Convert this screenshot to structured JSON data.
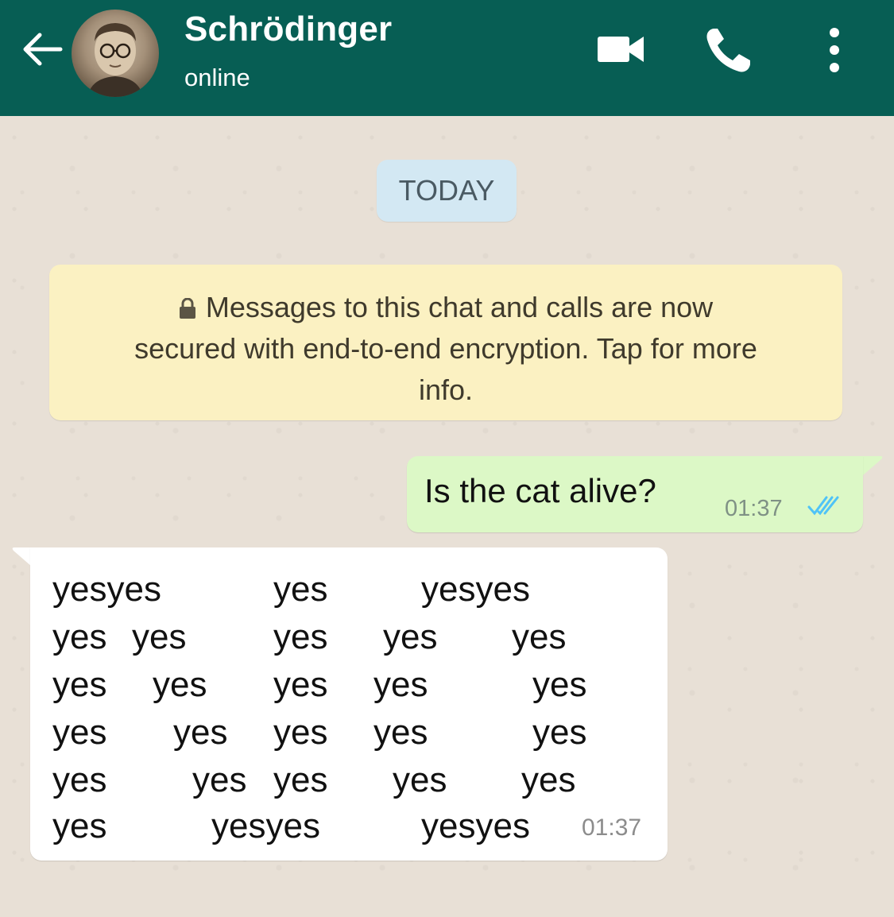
{
  "header": {
    "contact_name": "Schrödinger",
    "status": "online",
    "icons": [
      "back-arrow-icon",
      "avatar",
      "video-call-icon",
      "phone-icon",
      "more-options-icon"
    ],
    "background_color": "#075e54"
  },
  "chat": {
    "date_chip": "TODAY",
    "encryption_notice": {
      "line1": "Messages to this chat and calls are now",
      "line2": "secured with end-to-end encryption. Tap for more",
      "line3": "info."
    },
    "outgoing_message": {
      "text": "Is the cat alive?",
      "time": "01:37",
      "status": "read"
    },
    "incoming_message": {
      "rows": [
        [
          "yesyes",
          "yes",
          "yesyes"
        ],
        [
          "yes",
          "yes",
          "yes",
          "yes",
          "yes"
        ],
        [
          "yes",
          "yes",
          "yes",
          "yes",
          "yes"
        ],
        [
          "yes",
          "yes",
          "yes",
          "yes",
          "yes"
        ],
        [
          "yes",
          "yes",
          "yes",
          "yes",
          "yes"
        ],
        [
          "yes",
          "yesyes",
          "yesyes"
        ]
      ],
      "time": "01:37"
    }
  },
  "colors": {
    "outgoing_bubble": "#dcf8c6",
    "incoming_bubble": "#ffffff",
    "notice_bg": "#fbf1c2",
    "date_chip_bg": "#d3e8f3",
    "read_ticks": "#4fc3f7"
  }
}
